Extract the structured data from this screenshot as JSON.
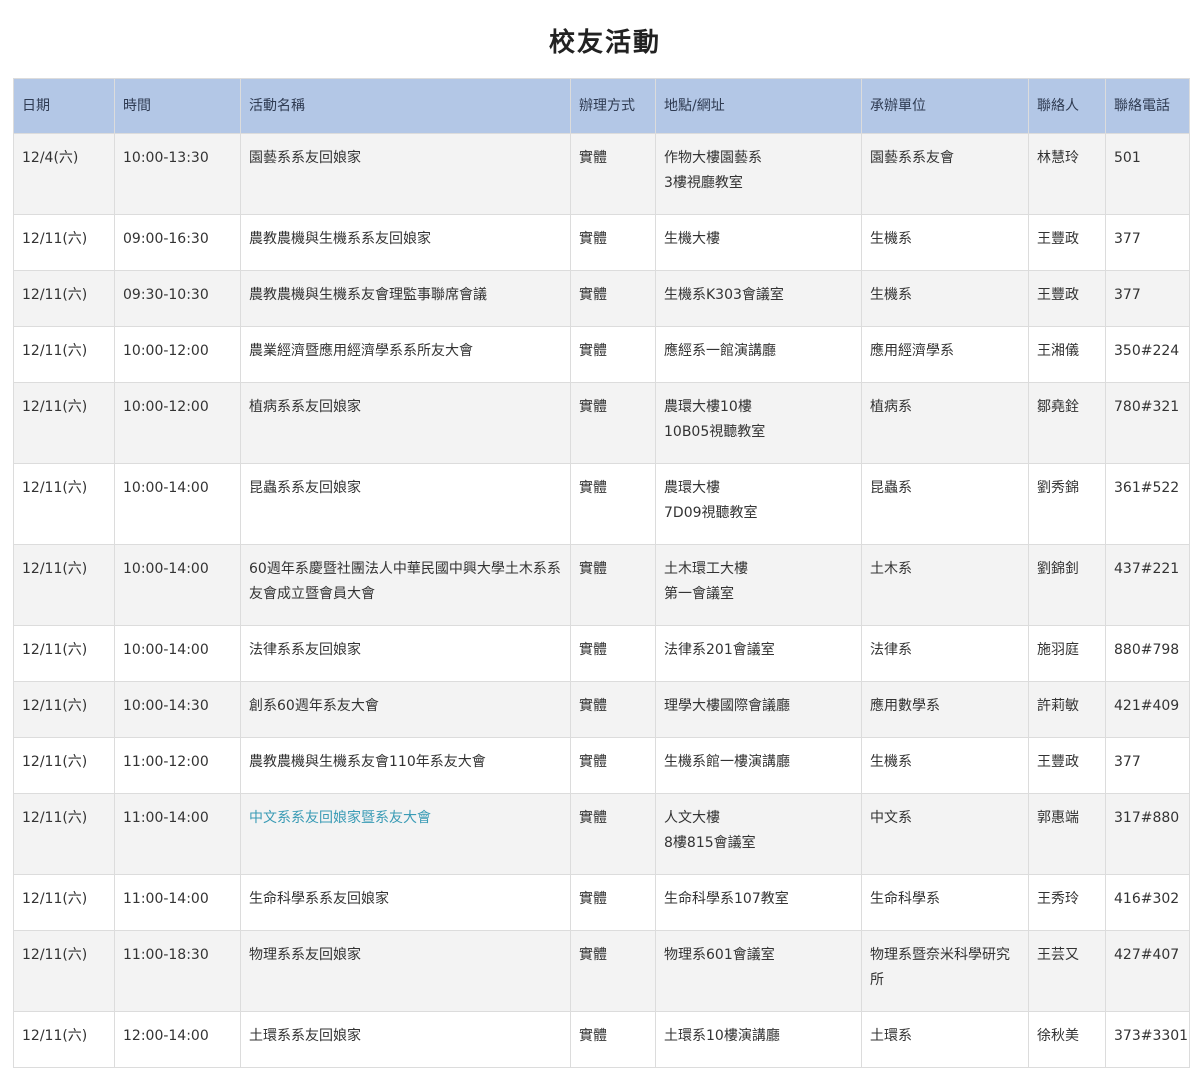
{
  "page": {
    "title": "校友活動"
  },
  "table": {
    "headers": [
      "日期",
      "時間",
      "活動名稱",
      "辦理方式",
      "地點/網址",
      "承辦單位",
      "聯絡人",
      "聯絡電話"
    ],
    "rows": [
      {
        "date": "12/4(六)",
        "time": "10:00-13:30",
        "name": "園藝系系友回娘家",
        "mode": "實體",
        "place": [
          "作物大樓園藝系",
          "3樓視廳教室"
        ],
        "unit": "園藝系系友會",
        "contact": "林慧玲",
        "phone": "501",
        "link": false
      },
      {
        "date": "12/11(六)",
        "time": "09:00-16:30",
        "name": "農教農機與生機系系友回娘家",
        "mode": "實體",
        "place": [
          "生機大樓"
        ],
        "unit": "生機系",
        "contact": "王豐政",
        "phone": "377",
        "link": false
      },
      {
        "date": "12/11(六)",
        "time": "09:30-10:30",
        "name": "農教農機與生機系友會理監事聯席會議",
        "mode": "實體",
        "place": [
          "生機系K303會議室"
        ],
        "unit": "生機系",
        "contact": "王豐政",
        "phone": "377",
        "link": false
      },
      {
        "date": "12/11(六)",
        "time": "10:00-12:00",
        "name": "農業經濟暨應用經濟學系系所友大會",
        "mode": "實體",
        "place": [
          "應經系一館演講廳"
        ],
        "unit": "應用經濟學系",
        "contact": "王湘儀",
        "phone": "350#224",
        "link": false
      },
      {
        "date": "12/11(六)",
        "time": "10:00-12:00",
        "name": "植病系系友回娘家",
        "mode": "實體",
        "place": [
          "農環大樓10樓",
          "10B05視聽教室"
        ],
        "unit": "植病系",
        "contact": "鄒堯銓",
        "phone": "780#321",
        "link": false
      },
      {
        "date": "12/11(六)",
        "time": "10:00-14:00",
        "name": "昆蟲系系友回娘家",
        "mode": "實體",
        "place": [
          "農環大樓",
          "7D09視聽教室"
        ],
        "unit": "昆蟲系",
        "contact": "劉秀錦",
        "phone": "361#522",
        "link": false
      },
      {
        "date": "12/11(六)",
        "time": "10:00-14:00",
        "name": "60週年系慶暨社團法人中華民國中興大學土木系系友會成立暨會員大會",
        "mode": "實體",
        "place": [
          "土木環工大樓",
          "第一會議室"
        ],
        "unit": "土木系",
        "contact": "劉錦釗",
        "phone": "437#221",
        "link": false
      },
      {
        "date": "12/11(六)",
        "time": "10:00-14:00",
        "name": "法律系系友回娘家",
        "mode": "實體",
        "place": [
          "法律系201會議室"
        ],
        "unit": "法律系",
        "contact": "施羽庭",
        "phone": "880#798",
        "link": false
      },
      {
        "date": "12/11(六)",
        "time": "10:00-14:30",
        "name": "創系60週年系友大會",
        "mode": "實體",
        "place": [
          "理學大樓國際會議廳"
        ],
        "unit": "應用數學系",
        "contact": "許莉敏",
        "phone": "421#409",
        "link": false
      },
      {
        "date": "12/11(六)",
        "time": "11:00-12:00",
        "name": "農教農機與生機系友會110年系友大會",
        "mode": "實體",
        "place": [
          "生機系館一樓演講廳"
        ],
        "unit": "生機系",
        "contact": "王豐政",
        "phone": "377",
        "link": false
      },
      {
        "date": "12/11(六)",
        "time": "11:00-14:00",
        "name": "中文系系友回娘家暨系友大會",
        "mode": "實體",
        "place": [
          "人文大樓",
          "8樓815會議室"
        ],
        "unit": "中文系",
        "contact": "郭惠端",
        "phone": "317#880",
        "link": true
      },
      {
        "date": "12/11(六)",
        "time": "11:00-14:00",
        "name": "生命科學系系友回娘家",
        "mode": "實體",
        "place": [
          "生命科學系107教室"
        ],
        "unit": "生命科學系",
        "contact": "王秀玲",
        "phone": "416#302",
        "link": false
      },
      {
        "date": "12/11(六)",
        "time": "11:00-18:30",
        "name": "物理系系友回娘家",
        "mode": "實體",
        "place": [
          "物理系601會議室"
        ],
        "unit": "物理系暨奈米科學研究所",
        "contact": "王芸又",
        "phone": "427#407",
        "link": false
      },
      {
        "date": "12/11(六)",
        "time": "12:00-14:00",
        "name": "土環系系友回娘家",
        "mode": "實體",
        "place": [
          "土環系10樓演講廳"
        ],
        "unit": "土環系",
        "contact": "徐秋美",
        "phone": "373#3301",
        "link": false
      }
    ]
  }
}
